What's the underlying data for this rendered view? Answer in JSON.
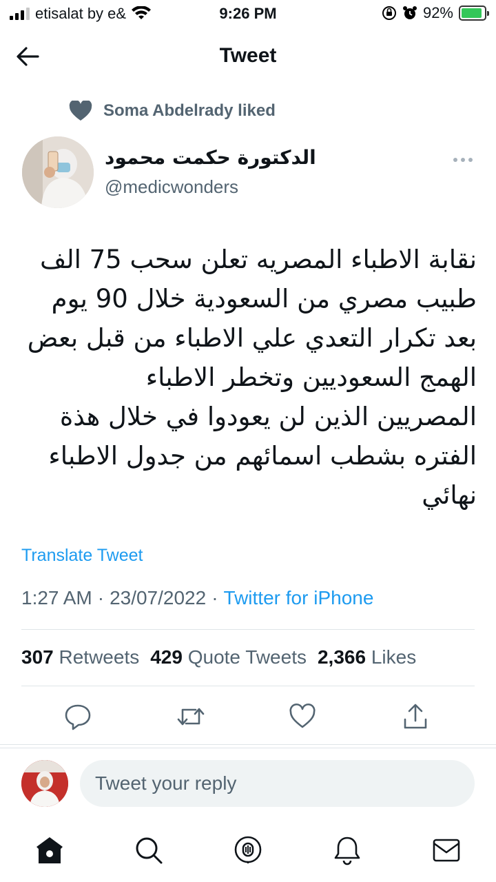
{
  "status_bar": {
    "carrier": "etisalat by e&",
    "time": "9:26 PM",
    "battery_percent": "92%",
    "battery_level": 0.92,
    "signal_bars": 4,
    "signal_active": 3,
    "icons": [
      "signal-icon",
      "wifi-icon",
      "orientation-lock-icon",
      "alarm-icon",
      "battery-charging-icon"
    ]
  },
  "header": {
    "title": "Tweet",
    "back_icon": "arrow-left-icon"
  },
  "social_context": {
    "icon": "heart-filled-icon",
    "text": "Soma Abdelrady liked"
  },
  "tweet": {
    "author_name": "الدكتورة حكمت محمود",
    "author_handle": "@medicwonders",
    "text": "نقابة الاطباء المصريه تعلن سحب 75 الف\nطبيب مصري من السعودية خلال 90 يوم\nبعد تكرار التعدي علي الاطباء من قبل بعض\nالهمج السعوديين وتخطر الاطباء\nالمصريين الذين لن يعودوا في خلال هذة\nالفتره بشطب اسمائهم من جدول الاطباء\nنهائي",
    "translate_label": "Translate Tweet",
    "time": "1:27 AM",
    "date": "23/07/2022",
    "separator": "·",
    "source": "Twitter for iPhone"
  },
  "stats": {
    "retweets_count": "307",
    "retweets_label": "Retweets",
    "quotes_count": "429",
    "quotes_label": "Quote Tweets",
    "likes_count": "2,366",
    "likes_label": "Likes"
  },
  "actions": [
    "reply-icon",
    "retweet-icon",
    "like-icon",
    "share-icon"
  ],
  "reply": {
    "placeholder": "Tweet your reply"
  },
  "tab_bar": [
    "home-icon",
    "search-icon",
    "spaces-icon",
    "notifications-icon",
    "messages-icon"
  ],
  "colors": {
    "accent": "#1d9bf0",
    "secondary_text": "#536471",
    "primary_text": "#0f1419",
    "battery_green": "#34c759"
  }
}
